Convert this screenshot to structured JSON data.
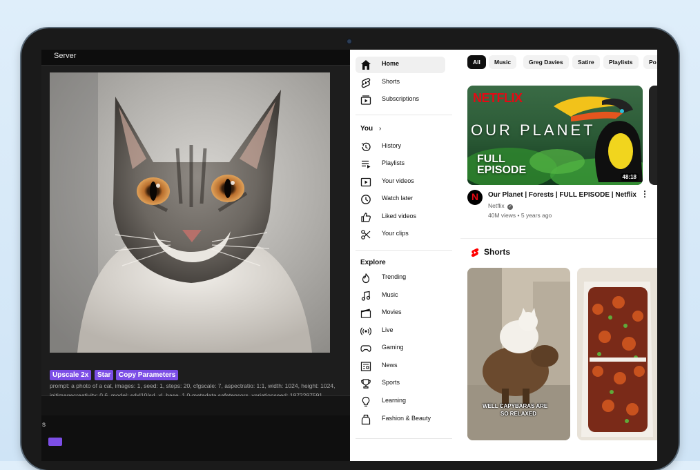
{
  "left_app": {
    "server_title": "Server",
    "buttons": {
      "upscale": "Upscale 2x",
      "star": "Star",
      "copy": "Copy Parameters"
    },
    "params_line1": "prompt: a photo of a cat, images: 1, seed: 1, steps: 20, cfgscale: 7, aspectratio: 1:1, width: 1024, height: 1024,",
    "params_line2": "initimagecreativity: 0.6, model: sdxl10/sd_xl_base_1.0-metadata.safetensors, variationseed: 1872297591,",
    "bottom_label": "s"
  },
  "youtube": {
    "sidebar": {
      "top_items": [
        {
          "label": "Home",
          "icon": "home-icon"
        },
        {
          "label": "Shorts",
          "icon": "shorts-icon"
        },
        {
          "label": "Subscriptions",
          "icon": "subscriptions-icon"
        }
      ],
      "you_title": "You",
      "you_items": [
        {
          "label": "History",
          "icon": "history-icon"
        },
        {
          "label": "Playlists",
          "icon": "playlists-icon"
        },
        {
          "label": "Your videos",
          "icon": "your-videos-icon"
        },
        {
          "label": "Watch later",
          "icon": "watch-later-icon"
        },
        {
          "label": "Liked videos",
          "icon": "liked-videos-icon"
        },
        {
          "label": "Your clips",
          "icon": "clips-icon"
        }
      ],
      "explore_title": "Explore",
      "explore_items": [
        {
          "label": "Trending",
          "icon": "trending-icon"
        },
        {
          "label": "Music",
          "icon": "music-icon"
        },
        {
          "label": "Movies",
          "icon": "movies-icon"
        },
        {
          "label": "Live",
          "icon": "live-icon"
        },
        {
          "label": "Gaming",
          "icon": "gaming-icon"
        },
        {
          "label": "News",
          "icon": "news-icon"
        },
        {
          "label": "Sports",
          "icon": "sports-icon"
        },
        {
          "label": "Learning",
          "icon": "learning-icon"
        },
        {
          "label": "Fashion & Beauty",
          "icon": "fashion-icon"
        }
      ]
    },
    "chips": [
      "All",
      "Music",
      "Greg Davies",
      "Satire",
      "Playlists",
      "Po"
    ],
    "video": {
      "thumb_brand": "NETFLIX",
      "thumb_title": "OUR PLANET",
      "thumb_badge_line1": "FULL",
      "thumb_badge_line2": "EPISODE",
      "duration": "48:18",
      "title": "Our Planet | Forests | FULL EPISODE | Netflix",
      "channel": "Netflix",
      "meta": "40M views • 5 years ago",
      "avatar_letter": "N"
    },
    "shorts_title": "Shorts",
    "short1_caption_line1": "WELL CAPYBARAS ARE",
    "short1_caption_line2": "SO RELAXED"
  },
  "colors": {
    "accent_purple": "#7c4ee6",
    "youtube_red": "#ff0000",
    "netflix_red": "#e50914"
  }
}
